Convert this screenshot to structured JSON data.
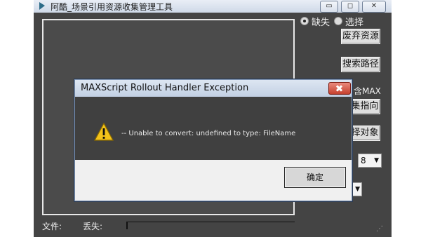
{
  "window": {
    "title": "阿酷_场景引用资源收集管理工具",
    "minimize": "▭",
    "restore": "◻",
    "close": "✕"
  },
  "options": {
    "missing_label": "缺失",
    "select_label": "选择"
  },
  "buttons": {
    "discard": "废弃资源",
    "search_path": "搜索路径",
    "include_max_partial": "含MAX",
    "collect_partial": "集指向",
    "select_obj_partial": "择对象"
  },
  "combo": {
    "value": "8",
    "arrow": "▼"
  },
  "footer": {
    "file_label": "文件:",
    "missing_label": "丢失:"
  },
  "dialog": {
    "title": "MAXScript Rollout Handler Exception",
    "message": "-- Unable to convert: undefined to type: FileName",
    "ok": "确定"
  },
  "colors": {
    "accent": "#c6412f",
    "window_bg": "#444444"
  }
}
